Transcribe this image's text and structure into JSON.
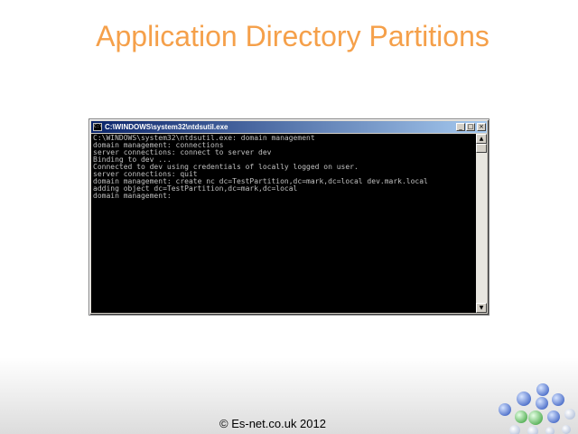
{
  "slide": {
    "title": "Application Directory Partitions",
    "footer": "© Es-net.co.uk 2012"
  },
  "window": {
    "title": "C:\\WINDOWS\\system32\\ntdsutil.exe",
    "minimize_icon": "minimize-icon",
    "maximize_icon": "maximize-icon",
    "close_icon": "close-icon"
  },
  "console": {
    "lines": [
      "C:\\WINDOWS\\system32\\ntdsutil.exe: domain management",
      "domain management: connections",
      "server connections: connect to server dev",
      "Binding to dev ...",
      "Connected to dev using credentials of locally logged on user.",
      "server connections: quit",
      "domain management: create nc dc=TestPartition,dc=mark,dc=local dev.mark.local",
      "adding object dc=TestPartition,dc=mark,dc=local",
      "domain management:"
    ]
  },
  "colors": {
    "title": "#f5a04a",
    "console_bg": "#000000",
    "console_text": "#c0c0c0",
    "titlebar_start": "#0a246a",
    "titlebar_end": "#a6caf0"
  }
}
